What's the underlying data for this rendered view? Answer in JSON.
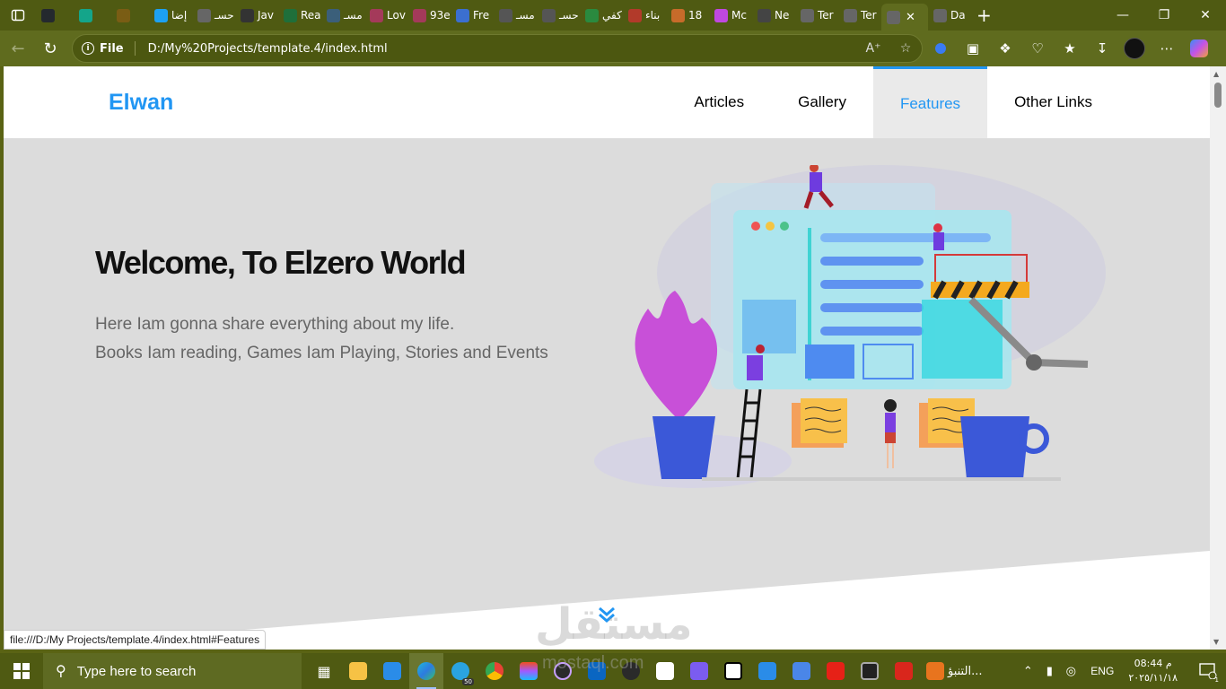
{
  "browser": {
    "tabs": [
      {
        "label": "",
        "favicon": "github-icon",
        "color": "#24292e"
      },
      {
        "label": "",
        "favicon": "diamond-icon",
        "color": "#14a58a"
      },
      {
        "label": "",
        "favicon": "s-icon",
        "color": "#7a5d14"
      },
      {
        "label": "إضا",
        "favicon": "circle-icon",
        "color": "#1da1f2"
      },
      {
        "label": "حسـ",
        "favicon": "globe-icon",
        "color": "#666"
      },
      {
        "label": "Jav",
        "favicon": "m-icon",
        "color": "#333"
      },
      {
        "label": "Rea",
        "favicon": "w-icon",
        "color": "#1f6f3a"
      },
      {
        "label": "مسـ",
        "favicon": "e-icon",
        "color": "#3b5f7a"
      },
      {
        "label": "Lov",
        "favicon": "figure-icon",
        "color": "#a43a5a"
      },
      {
        "label": "93e",
        "favicon": "figure-icon",
        "color": "#a43a5a"
      },
      {
        "label": "Fre",
        "favicon": "doc-icon",
        "color": "#3b6fd0"
      },
      {
        "label": "مسـ",
        "favicon": "search-icon",
        "color": "#555"
      },
      {
        "label": "حسـ",
        "favicon": "search-icon",
        "color": "#555"
      },
      {
        "label": "كفي",
        "favicon": "k-icon",
        "color": "#2a8a3f"
      },
      {
        "label": "بناء",
        "favicon": "figure-icon",
        "color": "#b23a2a"
      },
      {
        "label": "18",
        "favicon": "figure-icon",
        "color": "#c76b2a"
      },
      {
        "label": "Mc",
        "favicon": "heart-icon",
        "color": "#c048e0"
      },
      {
        "label": "Ne",
        "favicon": "grid-icon",
        "color": "#444"
      },
      {
        "label": "Ter",
        "favicon": "globe-icon",
        "color": "#666"
      },
      {
        "label": "Ter",
        "favicon": "globe-icon",
        "color": "#666"
      },
      {
        "label": "",
        "favicon": "globe-icon",
        "color": "#666",
        "active": true
      },
      {
        "label": "Da",
        "favicon": "globe-icon",
        "color": "#666"
      }
    ],
    "file_label": "File",
    "url": "D:/My%20Projects/template.4/index.html",
    "status_url": "file:///D:/My Projects/template.4/index.html#Features"
  },
  "site": {
    "logo": "Elwan",
    "nav": [
      {
        "label": "Articles",
        "active": false
      },
      {
        "label": "Gallery",
        "active": false
      },
      {
        "label": "Features",
        "active": true
      },
      {
        "label": "Other Links",
        "active": false
      }
    ],
    "landing": {
      "title": "Welcome, To Elzero World",
      "line1": "Here Iam gonna share everything about my life.",
      "line2": "Books Iam reading, Games Iam Playing, Stories and Events"
    },
    "accent_color": "#2196f3",
    "landing_bg": "#dcdcdc"
  },
  "taskbar": {
    "search_placeholder": "Type here to search",
    "telegram_badge": "50",
    "app_label": "التنبؤ...",
    "language": "ENG",
    "time": "08:44 م",
    "date": "٢٠٢٥/١١/١٨",
    "notification_count": "1"
  },
  "watermark": {
    "text": "مستقل",
    "sub": "mostaql.com"
  }
}
